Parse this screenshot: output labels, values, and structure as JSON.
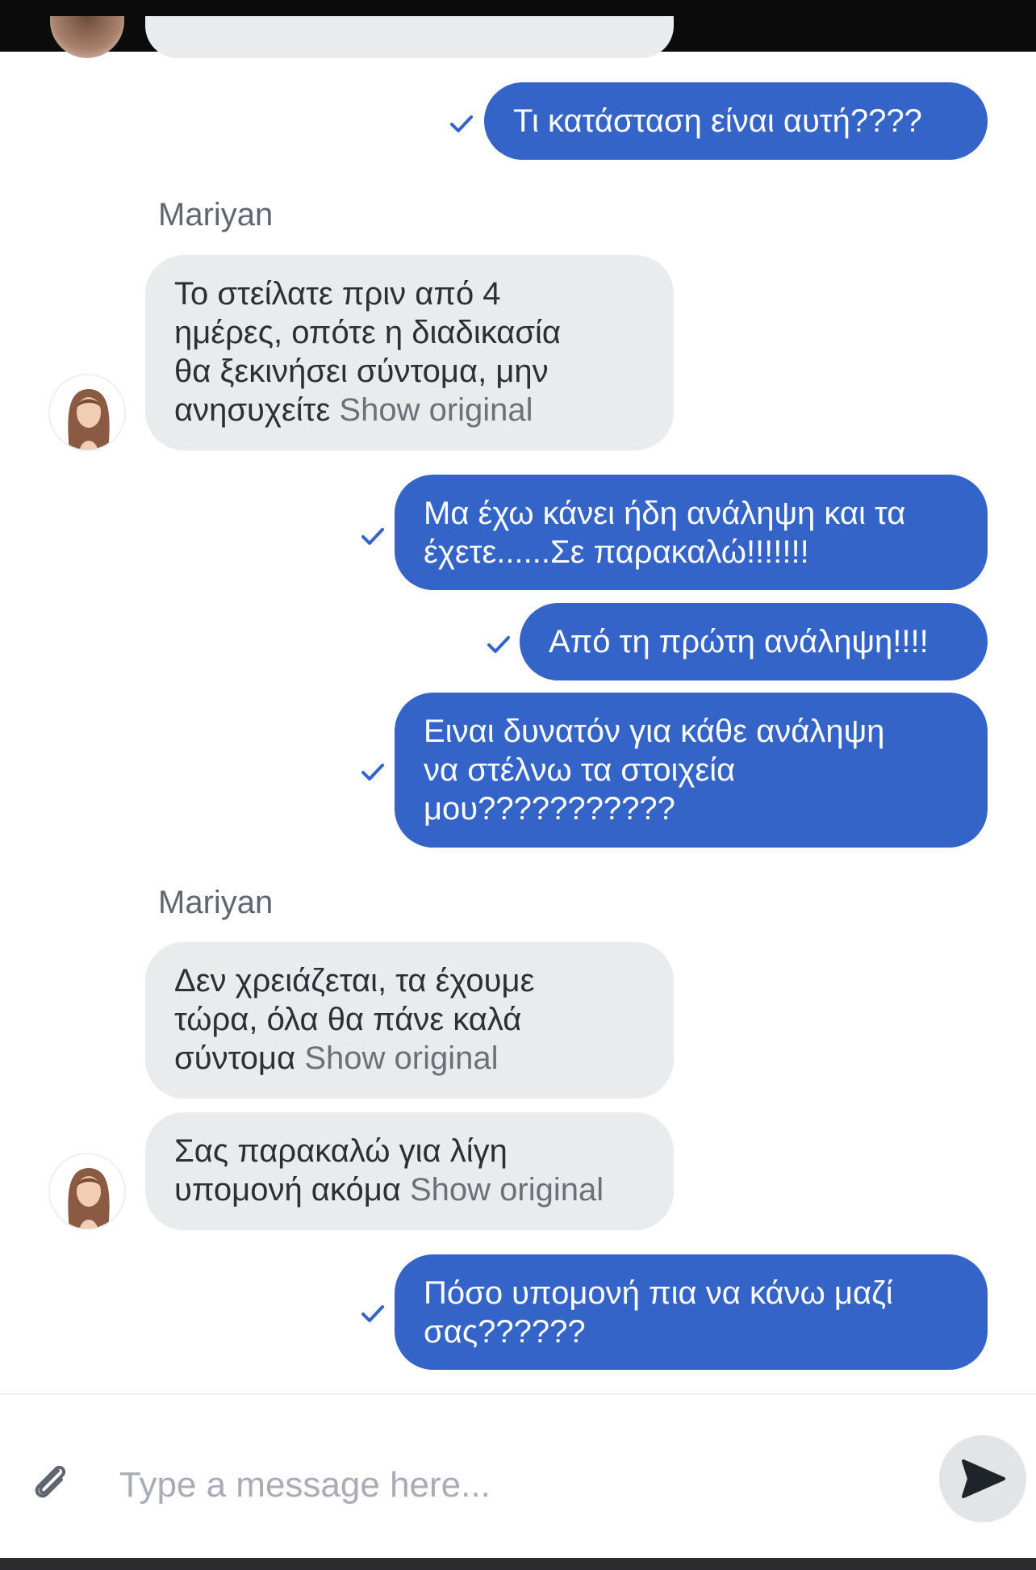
{
  "chat": {
    "sender_name": "Mariyan",
    "show_original_label": "Show original",
    "messages": [
      {
        "direction": "out",
        "status": "sent",
        "text": "Τι κατάσταση είναι αυτή????"
      },
      {
        "direction": "in",
        "sender": "Mariyan",
        "text": "Το στείλατε πριν από 4\nημέρες, οπότε η διαδικασία\nθα ξεκινήσει σύντομα, μην\nανησυχείτε",
        "show_original": "Show original"
      },
      {
        "direction": "out",
        "status": "sent",
        "text": "Μα έχω κάνει ήδη ανάληψη και τα\nέχετε......Σε παρακαλώ!!!!!!!"
      },
      {
        "direction": "out",
        "status": "sent",
        "text": "Από τη πρώτη ανάληψη!!!!"
      },
      {
        "direction": "out",
        "status": "sent",
        "text": "Ειναι δυνατόν για κάθε ανάληψη\nνα στέλνω τα στοιχεία\nμου???????????"
      },
      {
        "direction": "in",
        "sender": "Mariyan",
        "text": "Δεν χρειάζεται, τα έχουμε\nτώρα, όλα θα πάνε καλά\nσύντομα",
        "show_original": "Show original"
      },
      {
        "direction": "in",
        "sender": "Mariyan",
        "text": "Σας παρακαλώ για λίγη\nυπομονή ακόμα",
        "show_original": "Show original"
      },
      {
        "direction": "out",
        "status": "sent",
        "text": "Πόσο υπομονή πια να κάνω μαζί\nσας??????"
      }
    ]
  },
  "composer": {
    "placeholder": "Type a message here...",
    "value": "",
    "attach_icon": "paperclip-icon",
    "send_icon": "send-arrow-icon"
  },
  "colors": {
    "outgoing_bubble": "#3464c8",
    "incoming_bubble": "#eaebed",
    "check": "#3464c8",
    "sender_name": "#5f6672",
    "placeholder": "#a8adb5"
  }
}
